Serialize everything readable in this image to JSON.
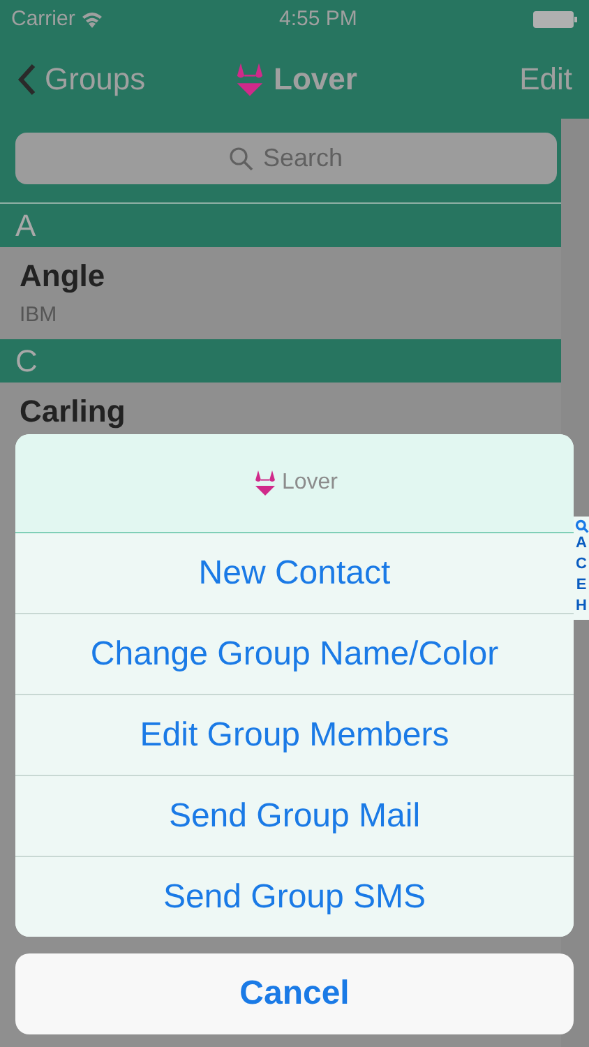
{
  "status_bar": {
    "carrier": "Carrier",
    "time": "4:55 PM"
  },
  "nav": {
    "back": "Groups",
    "title": "Lover",
    "action": "Edit"
  },
  "search": {
    "placeholder": "Search"
  },
  "sections": [
    {
      "letter": "A",
      "contacts": [
        {
          "name": "Angle",
          "company": "IBM"
        }
      ]
    },
    {
      "letter": "C",
      "contacts": [
        {
          "name": "Carling"
        }
      ]
    }
  ],
  "index": [
    "A",
    "C",
    "E",
    "H"
  ],
  "action_sheet": {
    "title": "Lover",
    "actions": [
      "New Contact",
      "Change Group Name/Color",
      "Edit Group Members",
      "Send Group Mail",
      "Send Group SMS"
    ],
    "cancel": "Cancel"
  }
}
